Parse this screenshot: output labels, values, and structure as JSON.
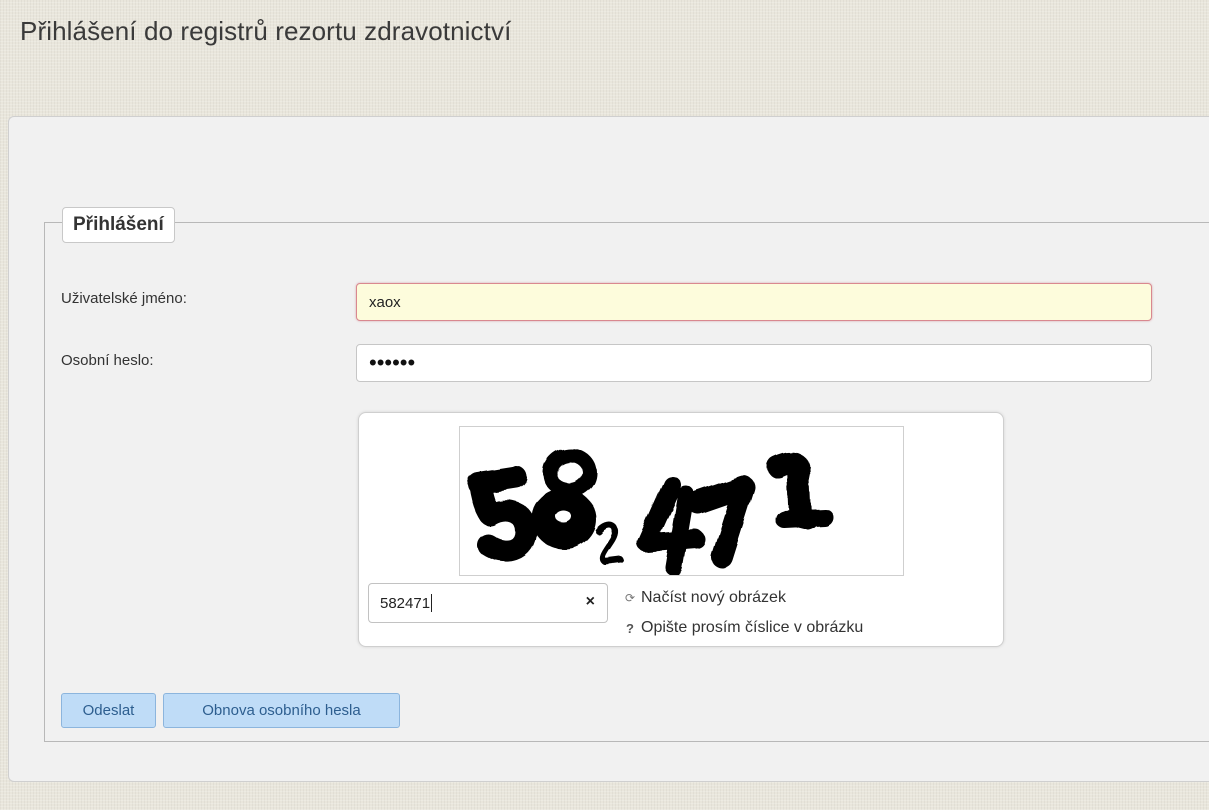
{
  "page": {
    "title": "Přihlášení do registrů rezortu zdravotnictví"
  },
  "login": {
    "legend": "Přihlášení",
    "username_label": "Uživatelské jméno:",
    "username_value": "xaox",
    "password_label": "Osobní heslo:",
    "password_mask": "••••••"
  },
  "captcha": {
    "image_text": "582471",
    "input_value": "582471",
    "clear_symbol": "×",
    "reload_label": "Načíst nový obrázek",
    "help_label": "Opište prosím číslice v obrázku",
    "reload_icon": "refresh-icon",
    "help_icon": "question-icon"
  },
  "buttons": {
    "submit_label": "Odeslat",
    "reset_password_label": "Obnova osobního hesla"
  },
  "colors": {
    "background": "#e9e6dc",
    "button_bg": "#bfdcf7",
    "button_text": "#2d5e8f",
    "focused_input_bg": "#fdfcdc",
    "focused_input_border": "#d9888f"
  }
}
